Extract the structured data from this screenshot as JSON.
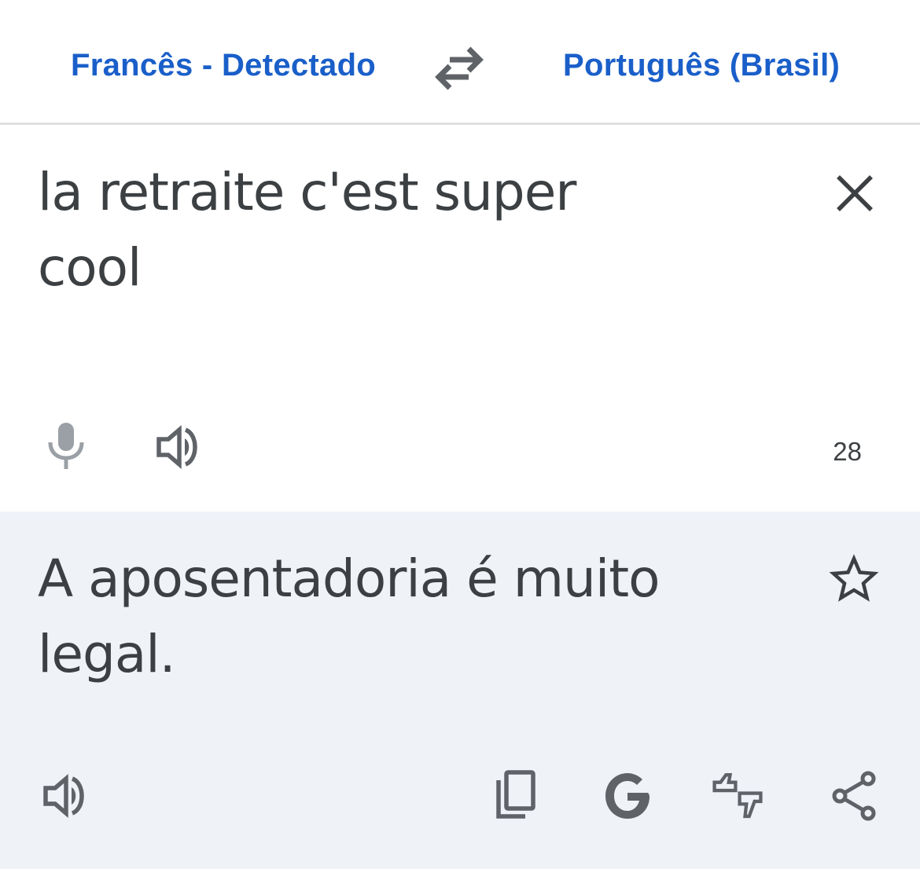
{
  "language_bar": {
    "source_language": "Francês - Detectado",
    "target_language": "Português (Brasil)",
    "swap_icon": "swap-arrows-icon"
  },
  "source": {
    "text": "la retraite c'est super cool",
    "char_count": "28",
    "clear_icon": "close-icon",
    "mic_icon": "microphone-icon",
    "speaker_icon": "speaker-icon"
  },
  "translation": {
    "text": "A aposentadoria é muito legal.",
    "star_icon": "star-icon",
    "tools": [
      "speaker-icon",
      "copy-icon",
      "google-icon",
      "feedback-icon",
      "share-icon"
    ]
  },
  "colors": {
    "accent": "#1a5fc9",
    "text": "#3c4043",
    "icon": "#5f6368",
    "translation_bg": "#eff2f7",
    "divider": "#e0e0e0"
  }
}
